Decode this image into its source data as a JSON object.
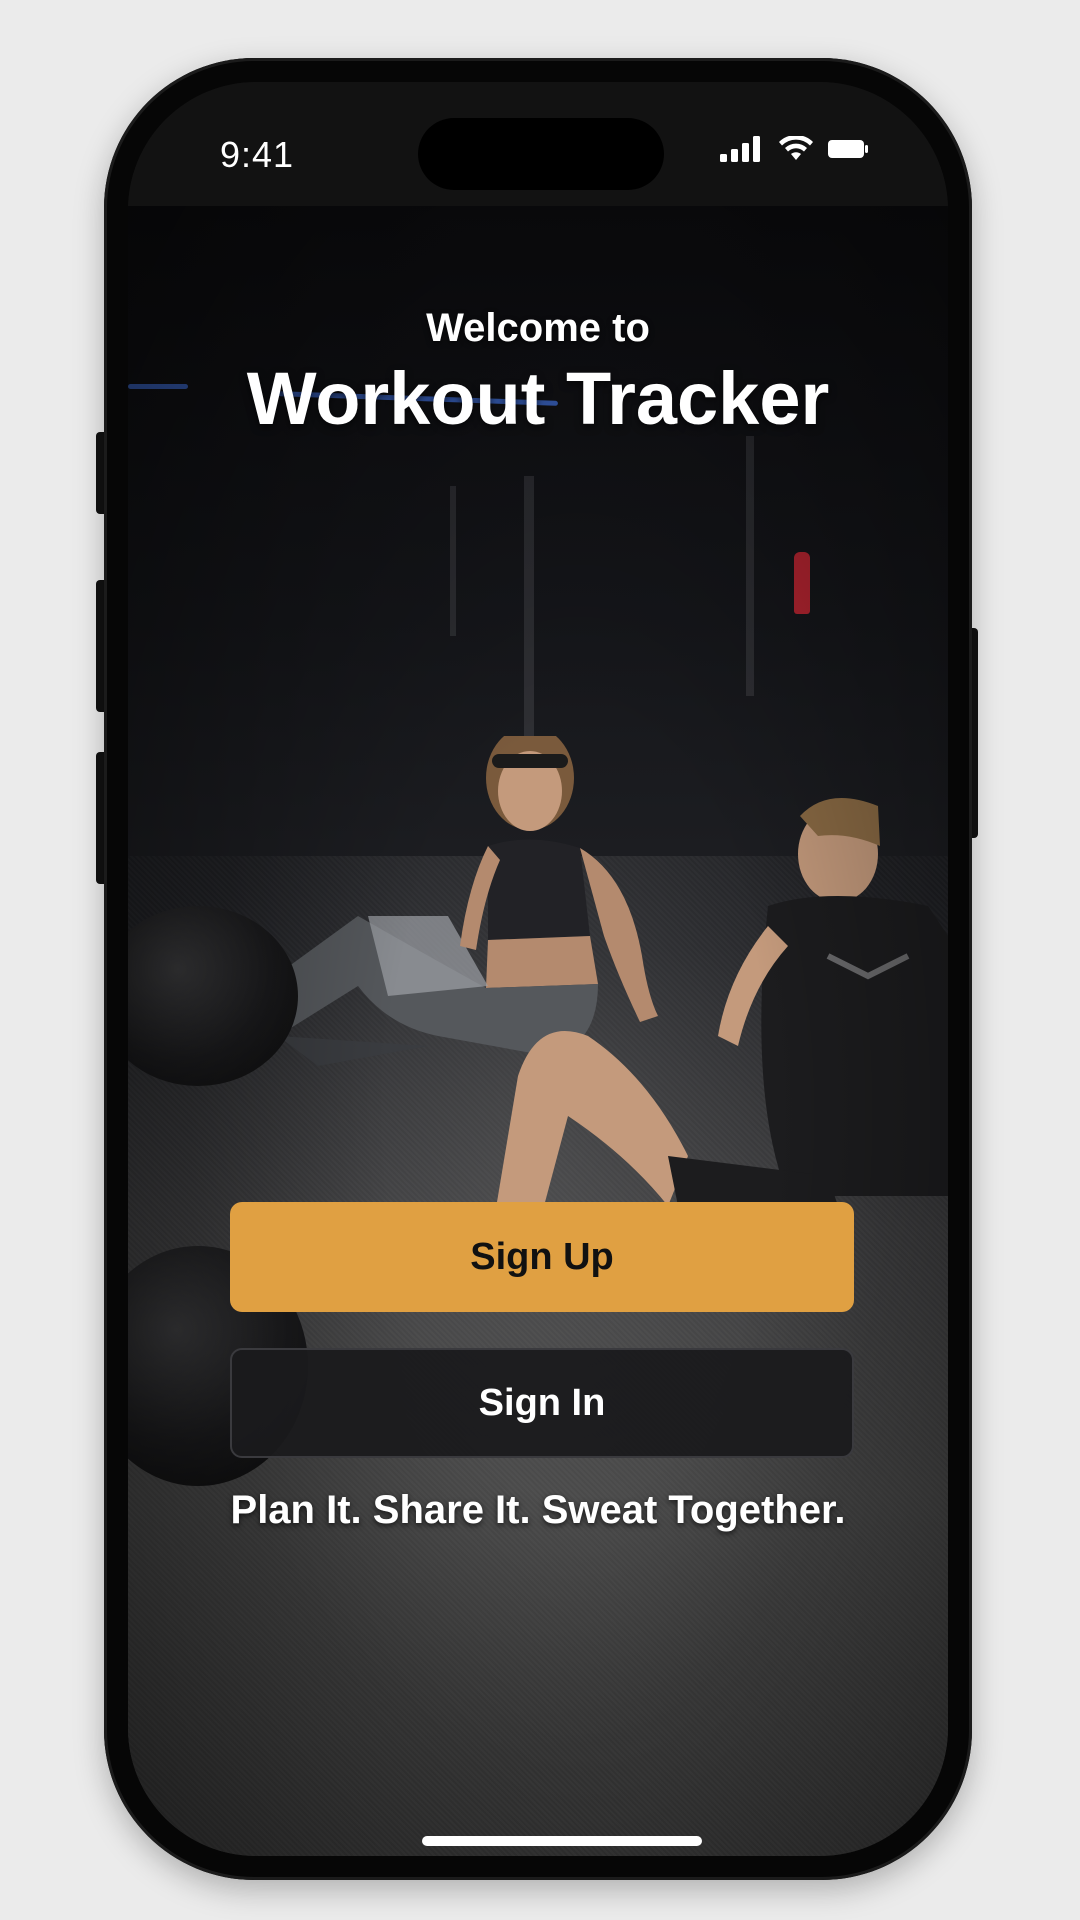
{
  "status_bar": {
    "time": "9:41",
    "icons": [
      "cellular-signal-icon",
      "wifi-icon",
      "battery-icon"
    ]
  },
  "hero": {
    "welcome_text": "Welcome to",
    "app_title": "Workout Tracker"
  },
  "actions": {
    "sign_up_label": "Sign Up",
    "sign_in_label": "Sign In"
  },
  "tagline": "Plan It. Share It. Sweat Together.",
  "colors": {
    "accent": "#e0a042",
    "secondary_button": "#1a1a1c",
    "text": "#ffffff",
    "background_outer": "#ebebeb"
  }
}
